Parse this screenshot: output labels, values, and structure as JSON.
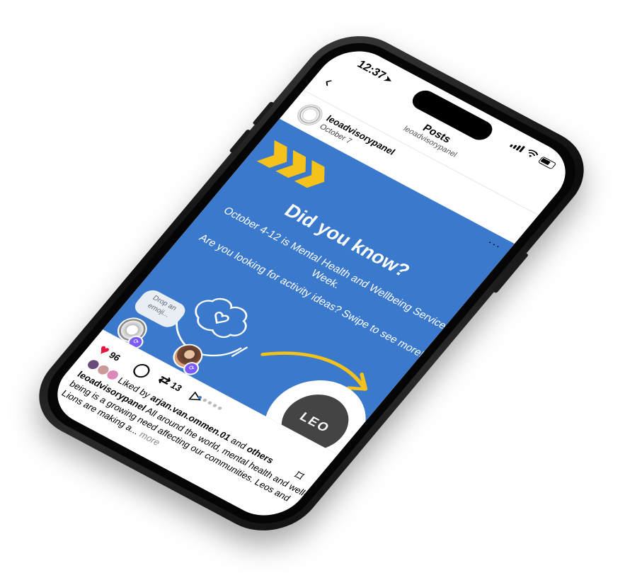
{
  "status": {
    "time": "12:37",
    "location_icon": "location-arrow-icon"
  },
  "header": {
    "title": "Posts",
    "subtitle": "leoadvisorypanel"
  },
  "post": {
    "username": "leoadvisorypanel",
    "date": "October 7",
    "image": {
      "headline": "Did you know?",
      "line1": "October 4-12 is Mental Health and Wellbeing Service Week.",
      "line2": "Are you looking for activity ideas? Swipe to see more!",
      "emoji_bubble": "Drop an emoji...",
      "logo_text": "LEO",
      "accent_color": "#f5c21b",
      "background_color": "#3a79cc"
    },
    "likes_count": "96",
    "reposts_count": "13",
    "liked_by_prefix": "Liked by ",
    "liked_by_user": "arjan.van.ommen.01",
    "liked_by_and": " and ",
    "liked_by_others": "others",
    "caption_user": "leoadvisorypanel",
    "caption_text": " All around the world, mental health and well-being is a growing need affecting our communities. Leos and Lions are making a...",
    "caption_more": " more"
  }
}
